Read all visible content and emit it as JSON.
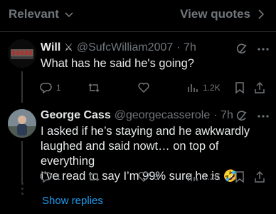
{
  "header": {
    "sort_label": "Relevant",
    "view_quotes_label": "View quotes"
  },
  "replies": [
    {
      "name": "Will",
      "badge": "⚔",
      "handle": "@SufcWilliam2007",
      "time": "· 7h",
      "text": "What has he said he's going?",
      "stats": {
        "replies": "1",
        "reposts": "",
        "likes": "",
        "views": "1.2K"
      }
    },
    {
      "name": "George Cass",
      "handle": "@georgecasserole",
      "time": "· 7h",
      "text_lines": [
        "I asked if he’s staying and he awkwardly",
        "laughed and said nowt… on top of everything",
        "I’ve read to say I’m 99% sure he is 🤣"
      ],
      "stats": {
        "replies": "1",
        "reposts": "",
        "likes": "3",
        "views": "1.2K"
      }
    }
  ],
  "show_replies_label": "Show replies",
  "colors": {
    "background": "#000000",
    "text": "#e7e9ea",
    "muted": "#71767b",
    "link": "#1d9bf0",
    "divider": "#2f3336"
  }
}
